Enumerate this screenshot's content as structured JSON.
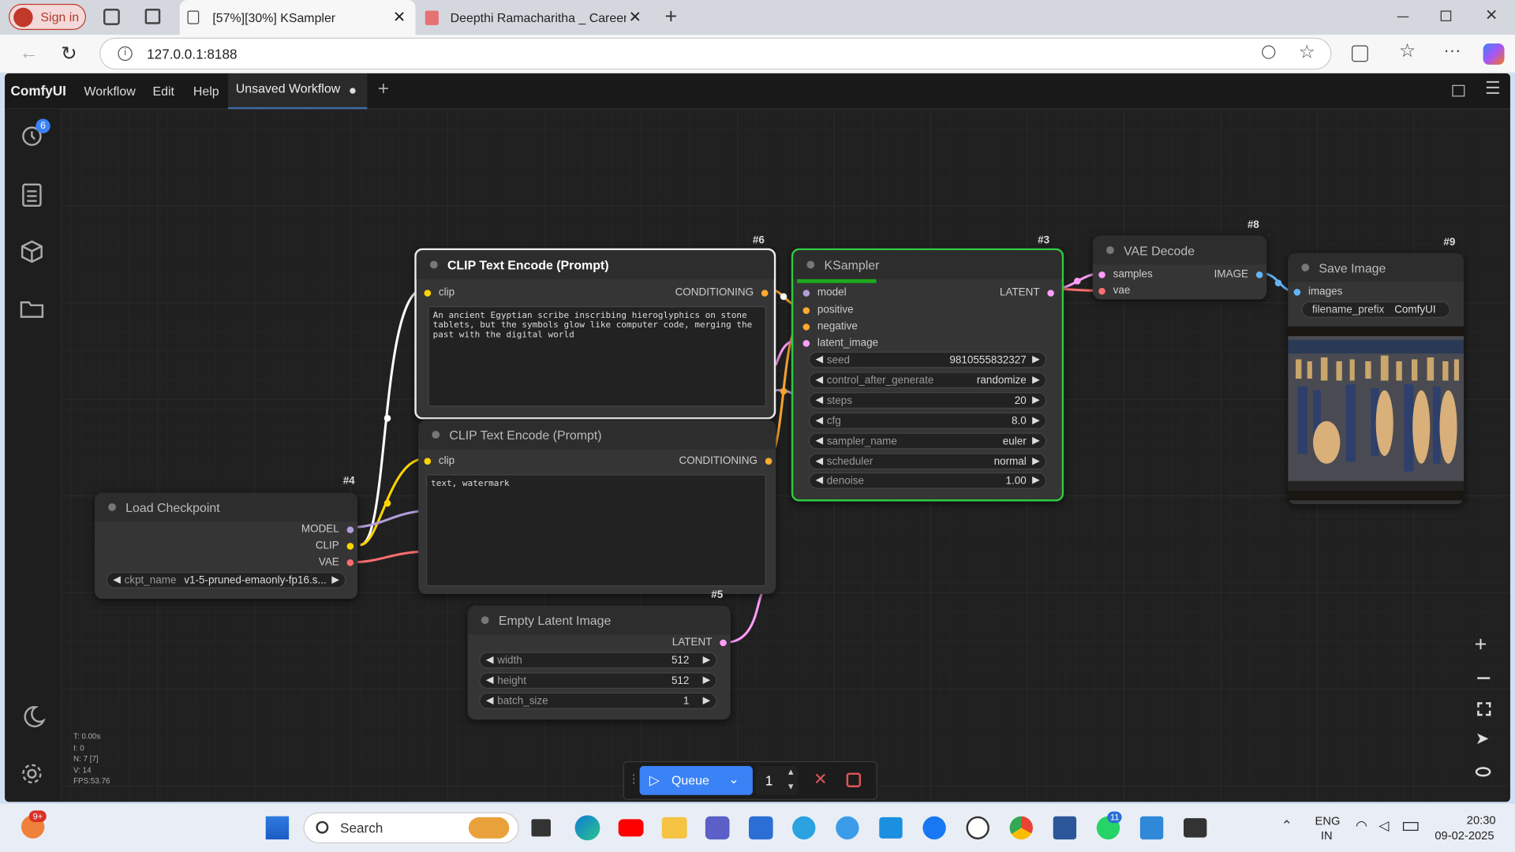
{
  "browser": {
    "signin": "Sign in",
    "tab_active": "[57%][30%] KSampler",
    "tab_other": "Deepthi Ramacharitha _ Career Ap",
    "url": "127.0.0.1:8188"
  },
  "menu": {
    "brand": "ComfyUI",
    "items": [
      "Workflow",
      "Edit",
      "Help"
    ],
    "workflow_tab": "Unsaved Workflow"
  },
  "sidebar": {
    "queue_badge": "6"
  },
  "nodes": {
    "clip_pos": {
      "id": "#6",
      "title": "CLIP Text Encode (Prompt)",
      "in": "clip",
      "out": "CONDITIONING",
      "text": "An ancient Egyptian scribe inscribing hieroglyphics on stone tablets, but the symbols glow like computer code, merging the past with the digital world"
    },
    "clip_neg": {
      "title": "CLIP Text Encode (Prompt)",
      "in": "clip",
      "out": "CONDITIONING",
      "text": "text, watermark"
    },
    "ksampler": {
      "id": "#3",
      "title": "KSampler",
      "inputs": [
        "model",
        "positive",
        "negative",
        "latent_image"
      ],
      "out": "LATENT",
      "widgets": [
        {
          "name": "seed",
          "value": "9810555832327"
        },
        {
          "name": "control_after_generate",
          "value": "randomize"
        },
        {
          "name": "steps",
          "value": "20"
        },
        {
          "name": "cfg",
          "value": "8.0"
        },
        {
          "name": "sampler_name",
          "value": "euler"
        },
        {
          "name": "scheduler",
          "value": "normal"
        },
        {
          "name": "denoise",
          "value": "1.00"
        }
      ]
    },
    "vae": {
      "id": "#8",
      "title": "VAE Decode",
      "inputs": [
        "samples",
        "vae"
      ],
      "out": "IMAGE"
    },
    "save": {
      "id": "#9",
      "title": "Save Image",
      "in": "images",
      "prefix_name": "filename_prefix",
      "prefix_value": "ComfyUI"
    },
    "ckpt": {
      "id": "#4",
      "title": "Load Checkpoint",
      "outputs": [
        "MODEL",
        "CLIP",
        "VAE"
      ],
      "widget_name": "ckpt_name",
      "widget_value": "v1-5-pruned-emaonly-fp16.s..."
    },
    "latent": {
      "id": "#5",
      "title": "Empty Latent Image",
      "out": "LATENT",
      "widgets": [
        {
          "name": "width",
          "value": "512"
        },
        {
          "name": "height",
          "value": "512"
        },
        {
          "name": "batch_size",
          "value": "1"
        }
      ]
    }
  },
  "stats": [
    "T: 0.00s",
    "I: 0",
    "N: 7 [7]",
    "V: 14",
    "FPS:53.76"
  ],
  "queue": {
    "label": "Queue",
    "count": "1"
  },
  "taskbar": {
    "search": "Search",
    "lang1": "ENG",
    "lang2": "IN",
    "time": "20:30",
    "date": "09-02-2025",
    "badge1": "9+",
    "badge2": "11"
  },
  "colors": {
    "clip": "#ffd500",
    "model": "#b39ddb",
    "vae": "#ff6e6e",
    "latent": "#ff9cf9",
    "cond": "#ffa931",
    "image": "#64b5f6",
    "clip_wire": "#ffffff"
  }
}
